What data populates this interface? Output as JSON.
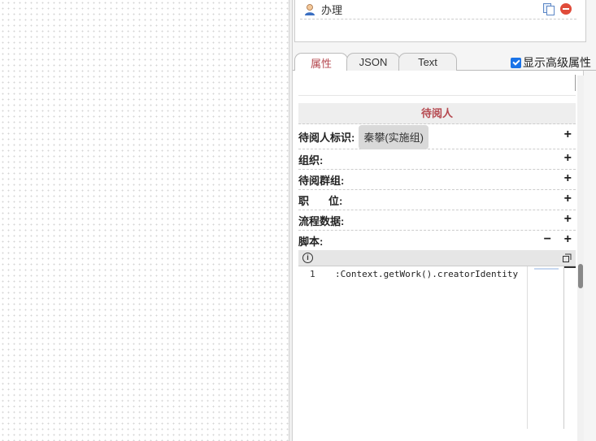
{
  "route": {
    "label": "办理"
  },
  "tabs": [
    {
      "label": "属性",
      "active": true
    },
    {
      "label": "JSON",
      "active": false
    },
    {
      "label": "Text",
      "active": false
    }
  ],
  "advanced": {
    "label": "显示高级属性",
    "checked": true
  },
  "section": {
    "title": "待阅人"
  },
  "props": {
    "identity": {
      "label": "待阅人标识:",
      "value": "秦攀(实施组)"
    },
    "org": {
      "label": "组织:"
    },
    "group": {
      "label": "待阅群组:"
    },
    "duty_a": "职",
    "duty_b": "位:",
    "flow_data": {
      "label": "流程数据:"
    },
    "script": {
      "label": "脚本:"
    },
    "plus": "+",
    "minus": "−"
  },
  "editor": {
    "line_number": "1",
    "code": ":Context.getWork().creatorIdentity"
  },
  "colors": {
    "accent": "#b5484f",
    "checkbox": "#1a73e8",
    "remove": "#e04b3a"
  }
}
